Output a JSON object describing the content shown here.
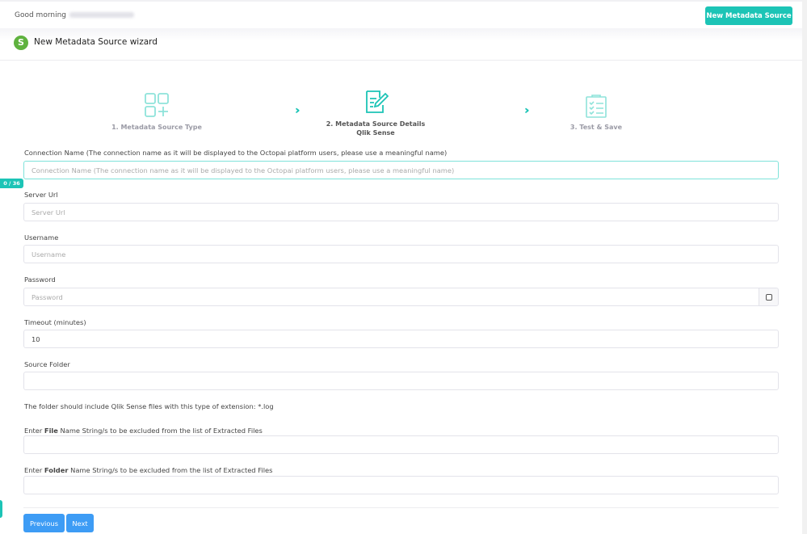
{
  "header": {
    "greeting": "Good morning",
    "new_button": "New Metadata Source"
  },
  "wizard": {
    "title": "New Metadata Source wizard",
    "logo_letter": "S",
    "steps": [
      {
        "label": "1. Metadata Source Type"
      },
      {
        "label": "2. Metadata Source Details",
        "sub": "Qlik Sense"
      },
      {
        "label": "3. Test & Save"
      }
    ]
  },
  "form": {
    "connection_name": {
      "label": "Connection Name (The connection name as it will be displayed to the Octopai platform users, please use a meaningful name)",
      "placeholder": "Connection Name (The connection name as it will be displayed to the Octopai platform users, please use a meaningful name)",
      "counter": "0 / 36"
    },
    "server_url": {
      "label": "Server Url",
      "placeholder": "Server Url"
    },
    "username": {
      "label": "Username",
      "placeholder": "Username"
    },
    "password": {
      "label": "Password",
      "placeholder": "Password"
    },
    "timeout": {
      "label": "Timeout (minutes)",
      "value": "10"
    },
    "source_folder": {
      "label": "Source Folder",
      "value": ""
    },
    "help": "The folder should include Qlik Sense files with this type of extension: *.log",
    "exclude_file": {
      "pre": "Enter ",
      "bold": "File",
      "post": " Name String/s to be excluded from the list of Extracted Files"
    },
    "exclude_folder": {
      "pre": "Enter ",
      "bold": "Folder",
      "post": " Name String/s to be excluded from the list of Extracted Files"
    }
  },
  "buttons": {
    "previous": "Previous",
    "next": "Next"
  },
  "colors": {
    "accent": "#1cc4b6",
    "primary": "#3d9cf5",
    "logo": "#5fb23f"
  }
}
